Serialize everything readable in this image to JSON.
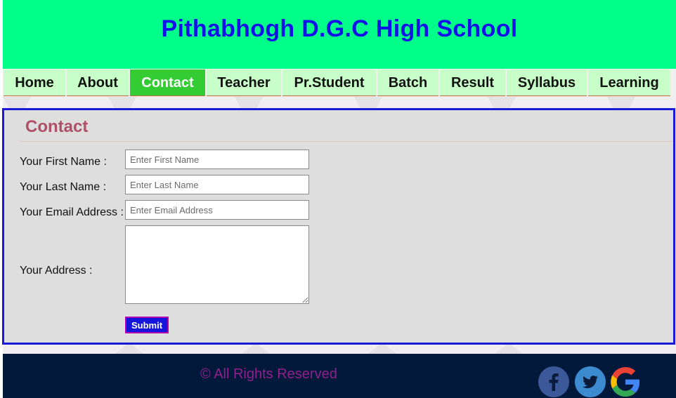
{
  "header": {
    "title": "Pithabhogh D.G.C High School"
  },
  "nav": {
    "items": [
      {
        "label": "Home"
      },
      {
        "label": "About"
      },
      {
        "label": "Contact",
        "active": true
      },
      {
        "label": "Teacher"
      },
      {
        "label": "Pr.Student"
      },
      {
        "label": "Batch"
      },
      {
        "label": "Result"
      },
      {
        "label": "Syllabus"
      },
      {
        "label": "Learning"
      }
    ]
  },
  "contact": {
    "title": "Contact",
    "first_name_label": "Your First Name :",
    "first_name_placeholder": "Enter First Name",
    "last_name_label": "Your Last Name :",
    "last_name_placeholder": "Enter Last Name",
    "email_label": "Your Email Address :",
    "email_placeholder": "Enter Email Address",
    "address_label": "Your Address :",
    "submit_label": "Submit"
  },
  "footer": {
    "copyright": "© All Rights Reserved",
    "social": [
      "facebook-icon",
      "twitter-icon",
      "google-icon"
    ]
  },
  "colors": {
    "header_bg": "#00ff88",
    "title": "#1212e8",
    "nav_bg": "#c8ffc8",
    "nav_active": "#33cc33",
    "panel_border": "#1a1ad8",
    "footer_bg": "#02193c",
    "copyright": "#92208c"
  }
}
